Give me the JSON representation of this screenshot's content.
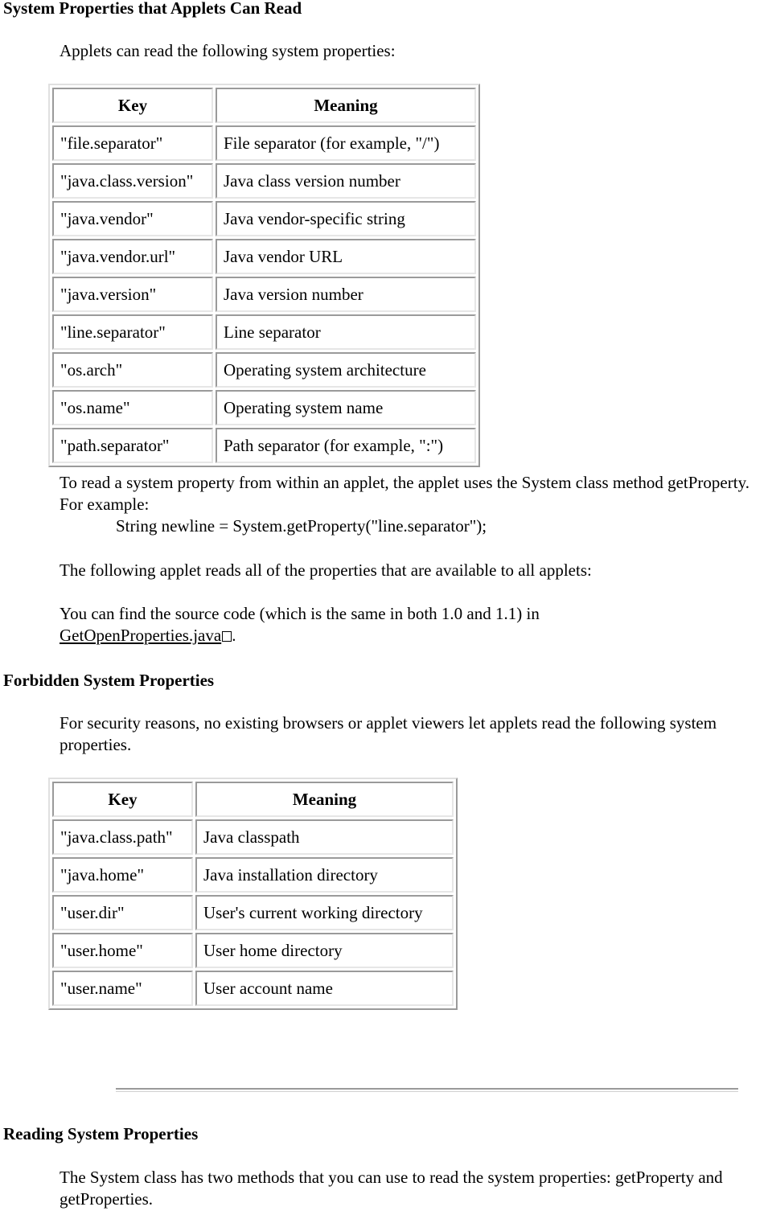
{
  "section1": {
    "heading": "System Properties that Applets Can Read",
    "intro": "Applets can read the following system properties:",
    "table": {
      "headers": [
        "Key",
        "Meaning"
      ],
      "rows": [
        [
          "\"file.separator\"",
          "File separator (for example, \"/\")"
        ],
        [
          "\"java.class.version\"",
          "Java class version number"
        ],
        [
          "\"java.vendor\"",
          "Java vendor-specific string"
        ],
        [
          "\"java.vendor.url\"",
          "Java vendor URL"
        ],
        [
          "\"java.version\"",
          "Java version number"
        ],
        [
          "\"line.separator\"",
          "Line separator"
        ],
        [
          "\"os.arch\"",
          "Operating system architecture"
        ],
        [
          "\"os.name\"",
          "Operating system name"
        ],
        [
          "\"path.separator\"",
          "Path separator (for example, \":\")"
        ]
      ]
    },
    "read_text": "To read a system property from within an applet, the applet uses the System class method getProperty. For example:",
    "code_example": "String newline = System.getProperty(\"line.separator\");",
    "applet_text": "The following applet reads all of the properties that are available to all applets:",
    "source_text": "You can find the source code (which is the same in both 1.0 and 1.1) in",
    "source_link": "GetOpenProperties.java",
    "source_link_icon": "external-link-box-icon",
    "source_trailing": "."
  },
  "section2": {
    "heading": "Forbidden System Properties",
    "intro": "For security reasons, no existing browsers or applet viewers let applets read the following system properties.",
    "table": {
      "headers": [
        "Key",
        "Meaning"
      ],
      "rows": [
        [
          "\"java.class.path\"",
          "Java classpath"
        ],
        [
          "\"java.home\"",
          "Java installation directory"
        ],
        [
          "\"user.dir\"",
          "User's current working directory"
        ],
        [
          "\"user.home\"",
          "User home directory"
        ],
        [
          "\"user.name\"",
          "User account name"
        ]
      ]
    }
  },
  "section3": {
    "heading": "Reading System Properties",
    "intro": "The System class has two methods that you can use to read the system properties: getProperty and getProperties."
  }
}
